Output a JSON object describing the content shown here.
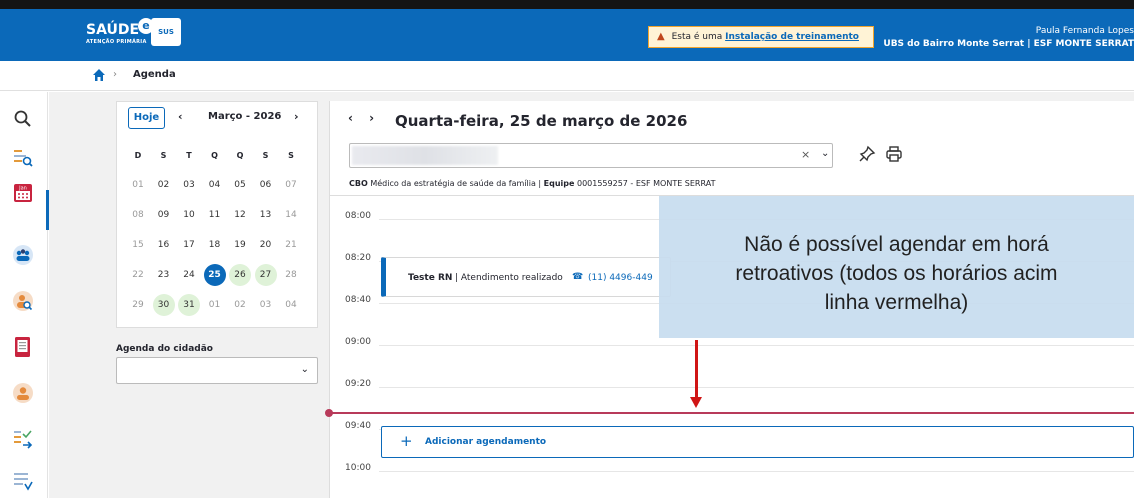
{
  "header": {
    "logo_text": "SAÚDE",
    "logo_badge": "e",
    "logo_plus_text": "SUS",
    "logo_sub": "ATENÇÃO PRIMÁRIA",
    "banner_text": "Esta é uma",
    "banner_link": "Instalação de treinamento",
    "user_name": "Paula Fernanda Lopes",
    "user_unit": "UBS do Bairro Monte Serrat | ESF MONTE SERRAT"
  },
  "breadcrumb": {
    "separator": "›",
    "current": "Agenda"
  },
  "left_nav": {
    "items": [
      "search-icon",
      "find-patient-icon",
      "calendar-icon",
      "group-icon",
      "person-search-icon",
      "cds-form-icon",
      "user-icon",
      "sort-list-icon",
      "list-settings-icon"
    ],
    "cal_icon_text": "Jan"
  },
  "calendar": {
    "today_button": "Hoje",
    "prev": "‹",
    "next": "›",
    "month": "Março - 2026",
    "weekdays": [
      "D",
      "S",
      "T",
      "Q",
      "Q",
      "S",
      "S"
    ],
    "weeks": [
      [
        "01",
        "02",
        "03",
        "04",
        "05",
        "06",
        "07"
      ],
      [
        "08",
        "09",
        "10",
        "11",
        "12",
        "13",
        "14"
      ],
      [
        "15",
        "16",
        "17",
        "18",
        "19",
        "20",
        "21"
      ],
      [
        "22",
        "23",
        "24",
        "25",
        "26",
        "27",
        "28"
      ],
      [
        "29",
        "30",
        "31",
        "01",
        "02",
        "03",
        "04"
      ]
    ],
    "selected": "25",
    "highlighted": [
      "26",
      "27",
      "30",
      "31"
    ],
    "dim_trailing": [
      "01",
      "02",
      "03",
      "04"
    ]
  },
  "citizen_agenda": {
    "label": "Agenda do cidadão",
    "value": ""
  },
  "main": {
    "nav_arrows": "‹ ›",
    "date_title": "Quarta-feira, 25 de março de 2026",
    "professional_select": {
      "clear": "×",
      "chevron": "⌄"
    },
    "cbo_label": "CBO",
    "cbo_value": "Médico da estratégia de saúde da família",
    "team_label": "Equipe",
    "team_value": "0001559257 - ESF MONTE SERRAT",
    "time_slots": [
      "08:00",
      "08:20",
      "08:40",
      "09:00",
      "09:20",
      "09:40",
      "10:00"
    ],
    "appointment": {
      "name": "Teste RN",
      "status": "| Atendimento realizado",
      "phone": "(11) 4496-449"
    },
    "add_button": {
      "plus": "+",
      "label": "Adicionar agendamento"
    }
  },
  "annotation": {
    "line1": "Não é possível agendar em horá",
    "line2": "retroativos (todos os horários acim",
    "line3": "linha vermelha)"
  },
  "colors": {
    "brand": "#0b69b9",
    "now_line": "#b83a5a",
    "arrow": "#d01515",
    "available_day": "#dff2d8",
    "overlay": "#c8ddef"
  }
}
